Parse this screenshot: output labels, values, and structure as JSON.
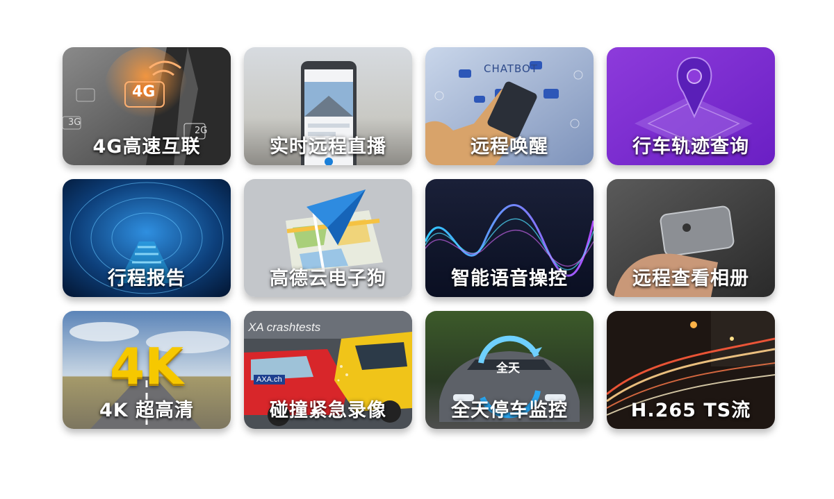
{
  "tiles": [
    {
      "label": "4G高速互联",
      "badge": "4G",
      "mini": [
        "2G",
        "3G",
        "2G"
      ]
    },
    {
      "label": "实时远程直播"
    },
    {
      "label": "远程唤醒",
      "heading": "CHATBOT"
    },
    {
      "label": "行车轨迹查询"
    },
    {
      "label": "行程报告"
    },
    {
      "label": "高德云电子狗"
    },
    {
      "label": "智能语音操控"
    },
    {
      "label": "远程查看相册"
    },
    {
      "label": "4K 超高清",
      "big": "4K"
    },
    {
      "label": "碰撞紧急录像",
      "banner": "XA crashtests",
      "badge": "AXA.ch"
    },
    {
      "label": "全天停车监控",
      "badge": "全天"
    },
    {
      "label": "H.265 TS流"
    }
  ],
  "colors": {
    "label_text": "#ffffff",
    "accent_purple": "#7b2fd6",
    "accent_blue": "#1a7fd8",
    "accent_gold": "#f6c800"
  }
}
